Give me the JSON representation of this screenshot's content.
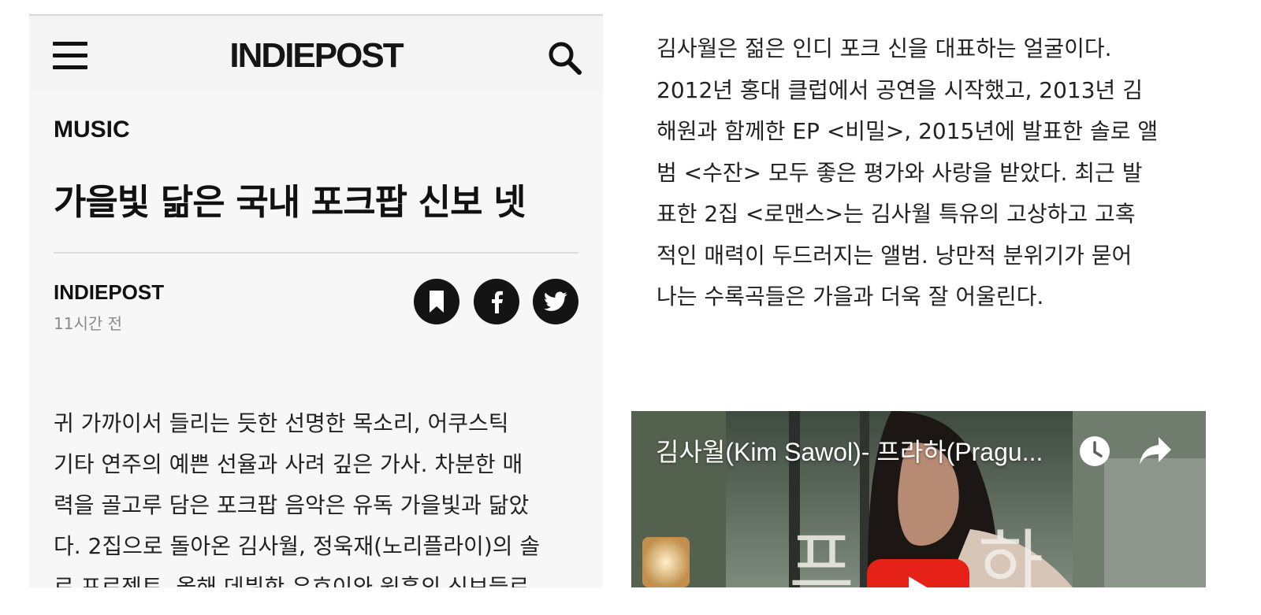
{
  "header": {
    "menu_icon": "hamburger-menu-icon",
    "logo_text": "INDIEPOST",
    "search_icon": "search-icon"
  },
  "article": {
    "category": "MUSIC",
    "title": "가을빛 닮은 국내 포크팝 신보 넷",
    "author": "INDIEPOST",
    "time_ago": "11시간 전",
    "share_icons": [
      "bookmark-icon",
      "facebook-icon",
      "twitter-icon"
    ],
    "body_left_lines": [
      "귀 가까이서 들리는 듯한 선명한 목소리, 어쿠스틱",
      "기타 연주의 예쁜 선율과 사려 깊은 가사. 차분한 매",
      "력을 골고루 담은 포크팝 음악은 유독 가을빛과 닮았",
      "다. 2집으로 돌아온 김사월, 정욱재(노리플라이)의 솔",
      "로 프로젝트, 올해 데뷔한 우효이와 원흥의 신보들로"
    ],
    "body_right_lines": [
      "김사월은 젊은 인디 포크 신을 대표하는 얼굴이다.",
      "2012년 홍대 클럽에서 공연을 시작했고, 2013년 김",
      "해원과 함께한 EP <비밀>, 2015년에 발표한 솔로 앨",
      "범 <수잔> 모두 좋은 평가와 사랑을 받았다. 최근 발",
      "표한 2집 <로맨스>는 김사월 특유의 고상하고 고혹",
      "적인 매력이 두드러지는 앨범. 낭만적 분위기가 묻어",
      "나는 수록곡들은 가을과 더욱 잘 어울린다."
    ]
  },
  "video": {
    "title": "김사월(Kim Sawol)- 프라하(Pragu...",
    "watch_later_icon": "clock-icon",
    "share_icon": "share-arrow-icon",
    "play_icon": "youtube-play-icon",
    "play_color": "#e62117"
  }
}
